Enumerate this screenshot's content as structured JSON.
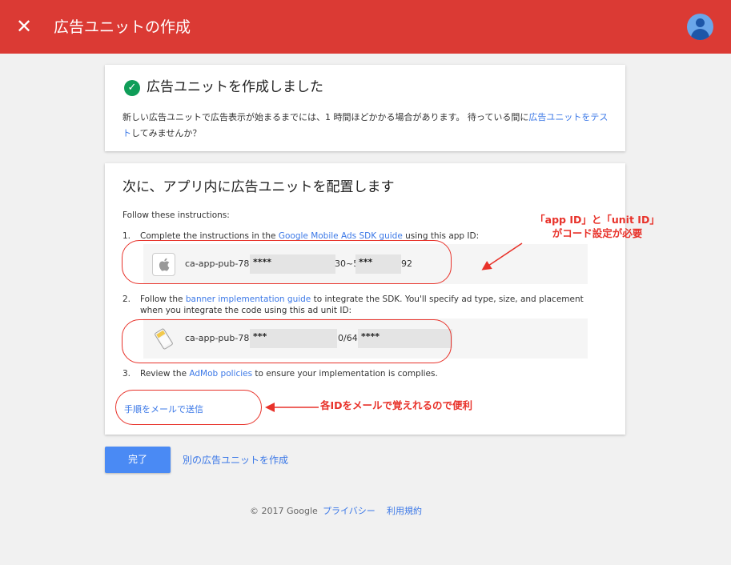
{
  "header": {
    "close_icon": "close-icon",
    "title": "広告ユニットの作成"
  },
  "success_card": {
    "title": "広告ユニットを作成しました",
    "text_before": "新しい広告ユニットで広告表示が始まるまでには、1 時間ほどかかる場合があります。 待っている間に",
    "link": "広告ユニットをテスト",
    "text_after": "してみませんか？"
  },
  "placement_card": {
    "title": "次に、アプリ内に広告ユニットを配置します",
    "follow": "Follow these instructions:",
    "step1": {
      "num": "1.",
      "before": "Complete the instructions in the ",
      "link": "Google Mobile Ads SDK guide",
      "after": " using this app ID:"
    },
    "app_id": {
      "prefix": "ca-app-pub-78",
      "mask1": "****",
      "middle": "30~5",
      "mask2": "***",
      "suffix": "92"
    },
    "step2": {
      "num": "2.",
      "before": "Follow the ",
      "link": "banner implementation guide",
      "after": " to integrate the SDK. You'll specify ad type, size, and placement when you integrate the code using this ad unit ID:"
    },
    "unit_id": {
      "prefix": "ca-app-pub-78",
      "mask1": "***",
      "middle": "0/64",
      "mask2": "****"
    },
    "step3": {
      "num": "3.",
      "before": "Review the ",
      "link": "AdMob policies",
      "after": " to ensure your implementation is complies."
    },
    "email_link": "手順をメールで送信"
  },
  "annotations": {
    "ids_line1": "「app ID」と「unit ID」",
    "ids_line2": "がコード設定が必要",
    "email_note": "各IDをメールで覚えれるので便利",
    "color": "#e8322a"
  },
  "actions": {
    "done": "完了",
    "another": "別の広告ユニットを作成"
  },
  "footer": {
    "copyright": "© 2017 Google",
    "privacy": "プライバシー",
    "terms": "利用規約"
  },
  "colors": {
    "header": "#db3a34",
    "link": "#3b78e7",
    "button": "#4a8af4",
    "success": "#0f9d58"
  }
}
